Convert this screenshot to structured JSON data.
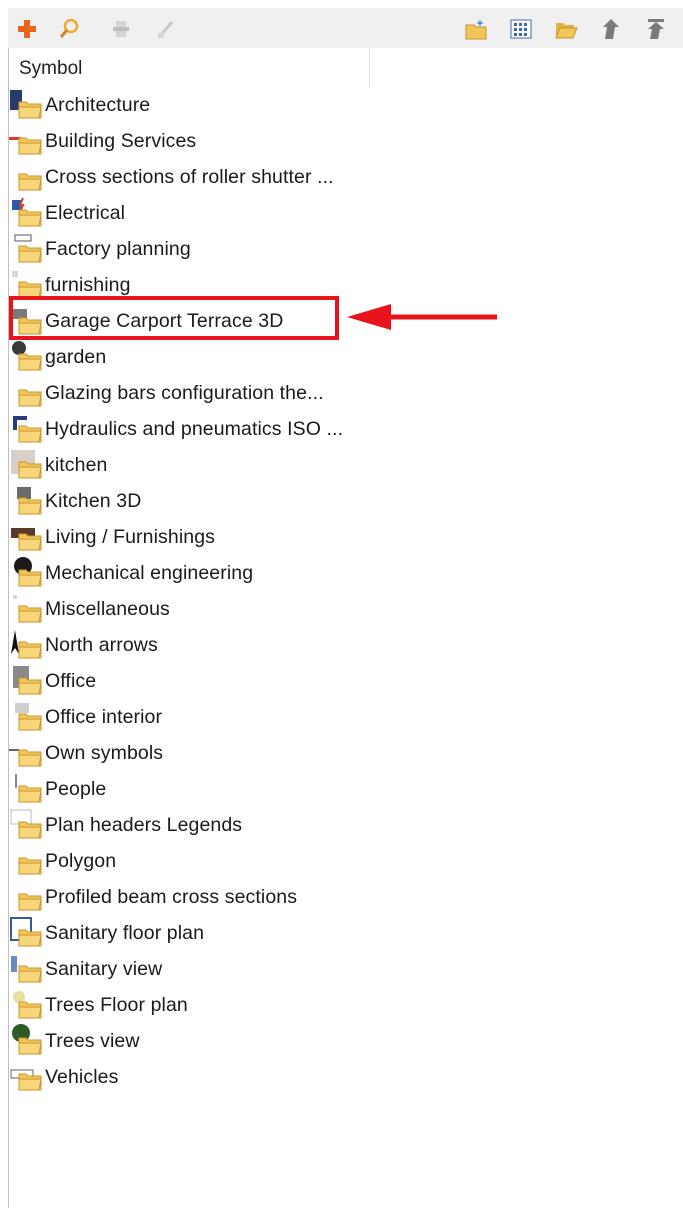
{
  "toolbar": {
    "left_icons": [
      "add-icon",
      "search-icon",
      "symbol-properties-icon",
      "edit-symbol-icon"
    ],
    "right_icons": [
      "new-folder-icon",
      "grid-view-icon",
      "open-folder-icon",
      "move-up-icon",
      "move-top-icon"
    ]
  },
  "tree": {
    "column_header": "Symbol",
    "items": [
      {
        "label": "Architecture",
        "icon": "architecture-folder-icon"
      },
      {
        "label": "Building Services",
        "icon": "building-services-folder-icon"
      },
      {
        "label": "Cross sections of roller shutter ...",
        "icon": "folder-icon"
      },
      {
        "label": "Electrical",
        "icon": "electrical-folder-icon"
      },
      {
        "label": "Factory planning",
        "icon": "factory-planning-folder-icon"
      },
      {
        "label": "furnishing",
        "icon": "furnishing-folder-icon"
      },
      {
        "label": "Garage Carport Terrace 3D",
        "icon": "garage-folder-icon"
      },
      {
        "label": "garden",
        "icon": "garden-folder-icon"
      },
      {
        "label": "Glazing bars configuration the...",
        "icon": "folder-icon"
      },
      {
        "label": "Hydraulics and pneumatics ISO ...",
        "icon": "hydraulics-folder-icon"
      },
      {
        "label": "kitchen",
        "icon": "kitchen-folder-icon"
      },
      {
        "label": "Kitchen 3D",
        "icon": "kitchen-3d-folder-icon"
      },
      {
        "label": "Living / Furnishings",
        "icon": "living-folder-icon"
      },
      {
        "label": "Mechanical engineering",
        "icon": "mechanical-folder-icon"
      },
      {
        "label": "Miscellaneous",
        "icon": "miscellaneous-folder-icon"
      },
      {
        "label": "North arrows",
        "icon": "north-arrow-folder-icon"
      },
      {
        "label": "Office",
        "icon": "office-folder-icon"
      },
      {
        "label": "Office interior",
        "icon": "office-interior-folder-icon"
      },
      {
        "label": "Own symbols",
        "icon": "own-symbols-folder-icon"
      },
      {
        "label": "People",
        "icon": "people-folder-icon"
      },
      {
        "label": "Plan headers Legends",
        "icon": "plan-headers-folder-icon"
      },
      {
        "label": "Polygon",
        "icon": "folder-icon"
      },
      {
        "label": "Profiled beam cross sections",
        "icon": "folder-icon"
      },
      {
        "label": "Sanitary floor plan",
        "icon": "sanitary-floor-plan-folder-icon"
      },
      {
        "label": "Sanitary view",
        "icon": "sanitary-view-folder-icon"
      },
      {
        "label": "Trees Floor plan",
        "icon": "trees-floor-plan-folder-icon"
      },
      {
        "label": "Trees view",
        "icon": "trees-view-folder-icon"
      },
      {
        "label": "Vehicles",
        "icon": "vehicles-folder-icon"
      }
    ]
  },
  "annotation": {
    "highlighted_item": "Garage Carport Terrace 3D",
    "box_color": "#e8141b",
    "arrow_color": "#e8141b"
  },
  "colors": {
    "folder": "#f3c65a",
    "folder_dark": "#d9a53a",
    "toolbar_bg": "#f0f0f0"
  }
}
